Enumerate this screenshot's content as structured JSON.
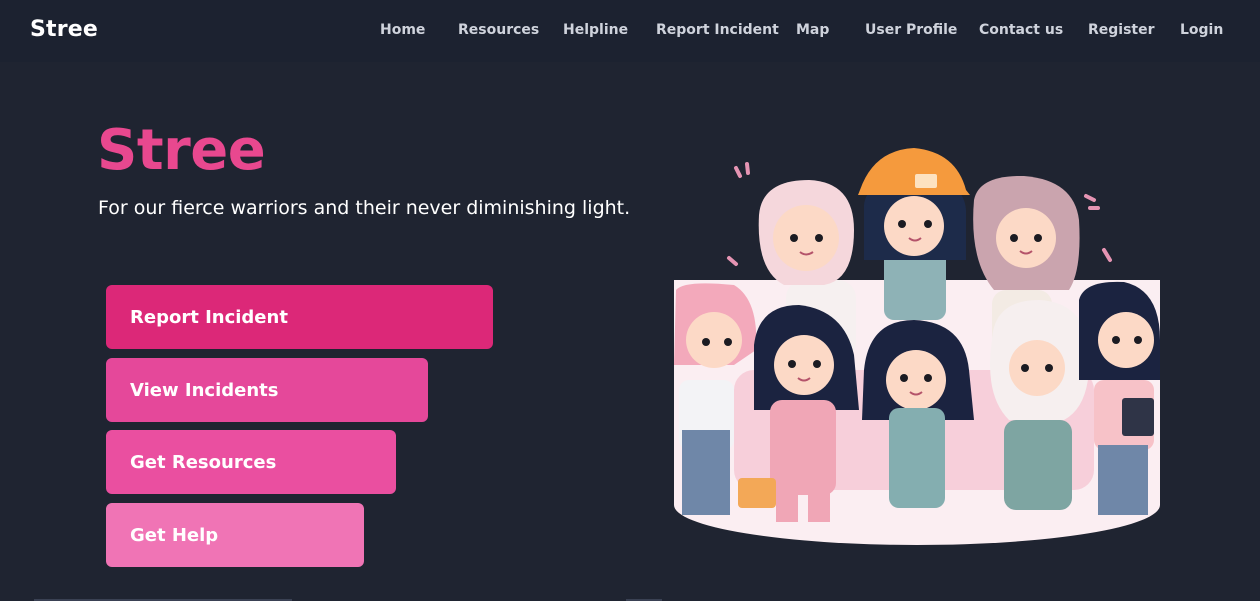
{
  "nav": {
    "brand": "Stree",
    "links": [
      "Home",
      "Resources",
      "Helpline",
      "Report Incident",
      "Map",
      "User Profile",
      "Contact us",
      "Register",
      "Login"
    ]
  },
  "hero": {
    "title": "Stree",
    "subtitle": "For our fierce warriors and their never diminishing light."
  },
  "actions": {
    "report": "Report Incident",
    "view": "View Incidents",
    "resources": "Get Resources",
    "help": "Get Help"
  },
  "colors": {
    "background": "#1f2431",
    "accent": "#e8488f",
    "button_primary": "#dc2878",
    "button_light": "#f074b5"
  }
}
